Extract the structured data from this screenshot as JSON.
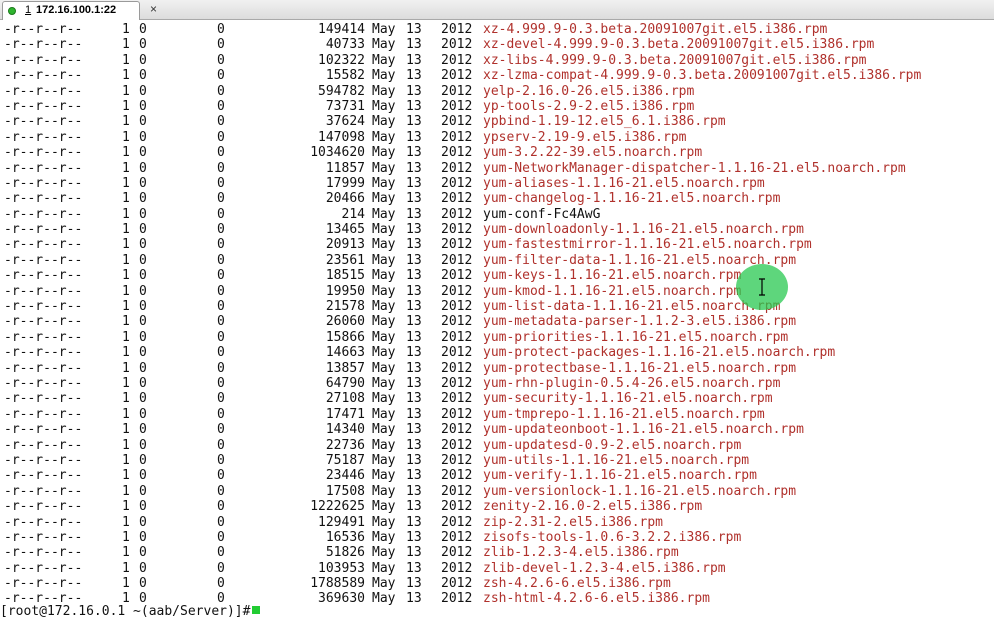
{
  "tab": {
    "number": "1",
    "title": "172.16.100.1:22",
    "close": "×"
  },
  "terminal": {
    "rows": [
      {
        "perm": "-r--r--r--",
        "links": "1",
        "owner": "0",
        "group": "0",
        "size": "149414",
        "month": "May",
        "day": "13",
        "year": "2012",
        "name": "xz-4.999.9-0.3.beta.20091007git.el5.i386.rpm",
        "rpm": true
      },
      {
        "perm": "-r--r--r--",
        "links": "1",
        "owner": "0",
        "group": "0",
        "size": "40733",
        "month": "May",
        "day": "13",
        "year": "2012",
        "name": "xz-devel-4.999.9-0.3.beta.20091007git.el5.i386.rpm",
        "rpm": true
      },
      {
        "perm": "-r--r--r--",
        "links": "1",
        "owner": "0",
        "group": "0",
        "size": "102322",
        "month": "May",
        "day": "13",
        "year": "2012",
        "name": "xz-libs-4.999.9-0.3.beta.20091007git.el5.i386.rpm",
        "rpm": true
      },
      {
        "perm": "-r--r--r--",
        "links": "1",
        "owner": "0",
        "group": "0",
        "size": "15582",
        "month": "May",
        "day": "13",
        "year": "2012",
        "name": "xz-lzma-compat-4.999.9-0.3.beta.20091007git.el5.i386.rpm",
        "rpm": true
      },
      {
        "perm": "-r--r--r--",
        "links": "1",
        "owner": "0",
        "group": "0",
        "size": "594782",
        "month": "May",
        "day": "13",
        "year": "2012",
        "name": "yelp-2.16.0-26.el5.i386.rpm",
        "rpm": true
      },
      {
        "perm": "-r--r--r--",
        "links": "1",
        "owner": "0",
        "group": "0",
        "size": "73731",
        "month": "May",
        "day": "13",
        "year": "2012",
        "name": "yp-tools-2.9-2.el5.i386.rpm",
        "rpm": true
      },
      {
        "perm": "-r--r--r--",
        "links": "1",
        "owner": "0",
        "group": "0",
        "size": "37624",
        "month": "May",
        "day": "13",
        "year": "2012",
        "name": "ypbind-1.19-12.el5_6.1.i386.rpm",
        "rpm": true
      },
      {
        "perm": "-r--r--r--",
        "links": "1",
        "owner": "0",
        "group": "0",
        "size": "147098",
        "month": "May",
        "day": "13",
        "year": "2012",
        "name": "ypserv-2.19-9.el5.i386.rpm",
        "rpm": true
      },
      {
        "perm": "-r--r--r--",
        "links": "1",
        "owner": "0",
        "group": "0",
        "size": "1034620",
        "month": "May",
        "day": "13",
        "year": "2012",
        "name": "yum-3.2.22-39.el5.noarch.rpm",
        "rpm": true
      },
      {
        "perm": "-r--r--r--",
        "links": "1",
        "owner": "0",
        "group": "0",
        "size": "11857",
        "month": "May",
        "day": "13",
        "year": "2012",
        "name": "yum-NetworkManager-dispatcher-1.1.16-21.el5.noarch.rpm",
        "rpm": true
      },
      {
        "perm": "-r--r--r--",
        "links": "1",
        "owner": "0",
        "group": "0",
        "size": "17999",
        "month": "May",
        "day": "13",
        "year": "2012",
        "name": "yum-aliases-1.1.16-21.el5.noarch.rpm",
        "rpm": true
      },
      {
        "perm": "-r--r--r--",
        "links": "1",
        "owner": "0",
        "group": "0",
        "size": "20466",
        "month": "May",
        "day": "13",
        "year": "2012",
        "name": "yum-changelog-1.1.16-21.el5.noarch.rpm",
        "rpm": true
      },
      {
        "perm": "-r--r--r--",
        "links": "1",
        "owner": "0",
        "group": "0",
        "size": "214",
        "month": "May",
        "day": "13",
        "year": "2012",
        "name": "yum-conf-Fc4AwG",
        "rpm": false
      },
      {
        "perm": "-r--r--r--",
        "links": "1",
        "owner": "0",
        "group": "0",
        "size": "13465",
        "month": "May",
        "day": "13",
        "year": "2012",
        "name": "yum-downloadonly-1.1.16-21.el5.noarch.rpm",
        "rpm": true
      },
      {
        "perm": "-r--r--r--",
        "links": "1",
        "owner": "0",
        "group": "0",
        "size": "20913",
        "month": "May",
        "day": "13",
        "year": "2012",
        "name": "yum-fastestmirror-1.1.16-21.el5.noarch.rpm",
        "rpm": true
      },
      {
        "perm": "-r--r--r--",
        "links": "1",
        "owner": "0",
        "group": "0",
        "size": "23561",
        "month": "May",
        "day": "13",
        "year": "2012",
        "name": "yum-filter-data-1.1.16-21.el5.noarch.rpm",
        "rpm": true
      },
      {
        "perm": "-r--r--r--",
        "links": "1",
        "owner": "0",
        "group": "0",
        "size": "18515",
        "month": "May",
        "day": "13",
        "year": "2012",
        "name": "yum-keys-1.1.16-21.el5.noarch.rpm",
        "rpm": true
      },
      {
        "perm": "-r--r--r--",
        "links": "1",
        "owner": "0",
        "group": "0",
        "size": "19950",
        "month": "May",
        "day": "13",
        "year": "2012",
        "name": "yum-kmod-1.1.16-21.el5.noarch.rpm",
        "rpm": true
      },
      {
        "perm": "-r--r--r--",
        "links": "1",
        "owner": "0",
        "group": "0",
        "size": "21578",
        "month": "May",
        "day": "13",
        "year": "2012",
        "name": "yum-list-data-1.1.16-21.el5.noarch.rpm",
        "rpm": true
      },
      {
        "perm": "-r--r--r--",
        "links": "1",
        "owner": "0",
        "group": "0",
        "size": "26060",
        "month": "May",
        "day": "13",
        "year": "2012",
        "name": "yum-metadata-parser-1.1.2-3.el5.i386.rpm",
        "rpm": true
      },
      {
        "perm": "-r--r--r--",
        "links": "1",
        "owner": "0",
        "group": "0",
        "size": "15866",
        "month": "May",
        "day": "13",
        "year": "2012",
        "name": "yum-priorities-1.1.16-21.el5.noarch.rpm",
        "rpm": true
      },
      {
        "perm": "-r--r--r--",
        "links": "1",
        "owner": "0",
        "group": "0",
        "size": "14663",
        "month": "May",
        "day": "13",
        "year": "2012",
        "name": "yum-protect-packages-1.1.16-21.el5.noarch.rpm",
        "rpm": true
      },
      {
        "perm": "-r--r--r--",
        "links": "1",
        "owner": "0",
        "group": "0",
        "size": "13857",
        "month": "May",
        "day": "13",
        "year": "2012",
        "name": "yum-protectbase-1.1.16-21.el5.noarch.rpm",
        "rpm": true
      },
      {
        "perm": "-r--r--r--",
        "links": "1",
        "owner": "0",
        "group": "0",
        "size": "64790",
        "month": "May",
        "day": "13",
        "year": "2012",
        "name": "yum-rhn-plugin-0.5.4-26.el5.noarch.rpm",
        "rpm": true
      },
      {
        "perm": "-r--r--r--",
        "links": "1",
        "owner": "0",
        "group": "0",
        "size": "27108",
        "month": "May",
        "day": "13",
        "year": "2012",
        "name": "yum-security-1.1.16-21.el5.noarch.rpm",
        "rpm": true
      },
      {
        "perm": "-r--r--r--",
        "links": "1",
        "owner": "0",
        "group": "0",
        "size": "17471",
        "month": "May",
        "day": "13",
        "year": "2012",
        "name": "yum-tmprepo-1.1.16-21.el5.noarch.rpm",
        "rpm": true
      },
      {
        "perm": "-r--r--r--",
        "links": "1",
        "owner": "0",
        "group": "0",
        "size": "14340",
        "month": "May",
        "day": "13",
        "year": "2012",
        "name": "yum-updateonboot-1.1.16-21.el5.noarch.rpm",
        "rpm": true
      },
      {
        "perm": "-r--r--r--",
        "links": "1",
        "owner": "0",
        "group": "0",
        "size": "22736",
        "month": "May",
        "day": "13",
        "year": "2012",
        "name": "yum-updatesd-0.9-2.el5.noarch.rpm",
        "rpm": true
      },
      {
        "perm": "-r--r--r--",
        "links": "1",
        "owner": "0",
        "group": "0",
        "size": "75187",
        "month": "May",
        "day": "13",
        "year": "2012",
        "name": "yum-utils-1.1.16-21.el5.noarch.rpm",
        "rpm": true
      },
      {
        "perm": "-r--r--r--",
        "links": "1",
        "owner": "0",
        "group": "0",
        "size": "23446",
        "month": "May",
        "day": "13",
        "year": "2012",
        "name": "yum-verify-1.1.16-21.el5.noarch.rpm",
        "rpm": true
      },
      {
        "perm": "-r--r--r--",
        "links": "1",
        "owner": "0",
        "group": "0",
        "size": "17508",
        "month": "May",
        "day": "13",
        "year": "2012",
        "name": "yum-versionlock-1.1.16-21.el5.noarch.rpm",
        "rpm": true
      },
      {
        "perm": "-r--r--r--",
        "links": "1",
        "owner": "0",
        "group": "0",
        "size": "1222625",
        "month": "May",
        "day": "13",
        "year": "2012",
        "name": "zenity-2.16.0-2.el5.i386.rpm",
        "rpm": true
      },
      {
        "perm": "-r--r--r--",
        "links": "1",
        "owner": "0",
        "group": "0",
        "size": "129491",
        "month": "May",
        "day": "13",
        "year": "2012",
        "name": "zip-2.31-2.el5.i386.rpm",
        "rpm": true
      },
      {
        "perm": "-r--r--r--",
        "links": "1",
        "owner": "0",
        "group": "0",
        "size": "16536",
        "month": "May",
        "day": "13",
        "year": "2012",
        "name": "zisofs-tools-1.0.6-3.2.2.i386.rpm",
        "rpm": true
      },
      {
        "perm": "-r--r--r--",
        "links": "1",
        "owner": "0",
        "group": "0",
        "size": "51826",
        "month": "May",
        "day": "13",
        "year": "2012",
        "name": "zlib-1.2.3-4.el5.i386.rpm",
        "rpm": true
      },
      {
        "perm": "-r--r--r--",
        "links": "1",
        "owner": "0",
        "group": "0",
        "size": "103953",
        "month": "May",
        "day": "13",
        "year": "2012",
        "name": "zlib-devel-1.2.3-4.el5.i386.rpm",
        "rpm": true
      },
      {
        "perm": "-r--r--r--",
        "links": "1",
        "owner": "0",
        "group": "0",
        "size": "1788589",
        "month": "May",
        "day": "13",
        "year": "2012",
        "name": "zsh-4.2.6-6.el5.i386.rpm",
        "rpm": true
      },
      {
        "perm": "-r--r--r--",
        "links": "1",
        "owner": "0",
        "group": "0",
        "size": "369630",
        "month": "May",
        "day": "13",
        "year": "2012",
        "name": "zsh-html-4.2.6-6.el5.i386.rpm",
        "rpm": true
      }
    ],
    "prompt": "[root@172.16.0.1 ~(aab/Server)]# "
  },
  "colors": {
    "filename": "#b0312c",
    "text": "#111111",
    "cursor": "#22cc33",
    "click_indicator": "#28c850"
  },
  "icons": {
    "tab_status": "connected-dot-icon",
    "pointer": "mouse-pointer-icon"
  }
}
